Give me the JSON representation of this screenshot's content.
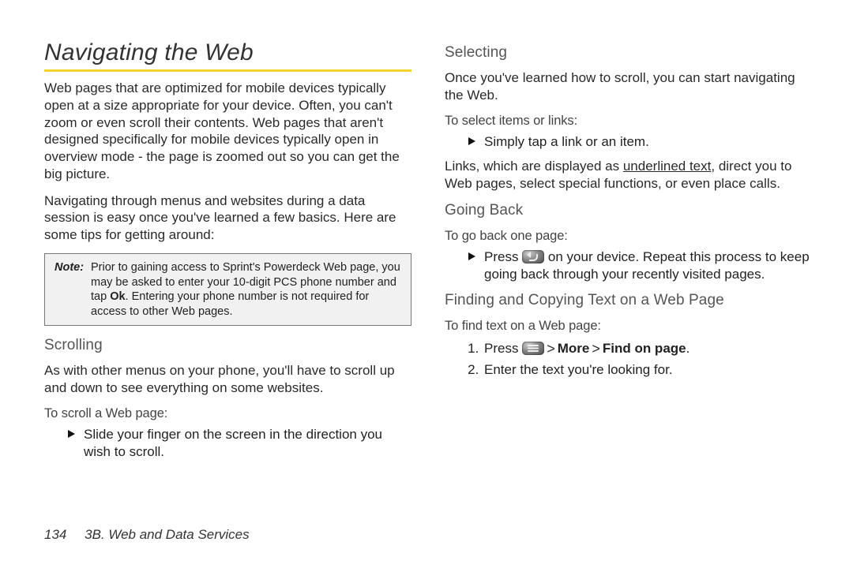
{
  "title": "Navigating the Web",
  "left": {
    "p1": "Web pages that are optimized for mobile devices typically open at a size appropriate for your device. Often, you can't zoom or even scroll their contents. Web pages that aren't designed specifically for mobile devices typically open in overview mode - the page is zoomed out so you can get the big picture.",
    "p2": "Navigating through menus and websites during a data session is easy once you've learned a few basics. Here are some tips for getting around:",
    "note_label": "Note:",
    "note_text_lead": "Prior to gaining access to Sprint's Powerdeck Web page, you may be asked to enter your 10-digit PCS phone number and tap ",
    "note_ok": "Ok",
    "note_text_tail": ". Entering your phone number is not required for access to other Web pages.",
    "scrolling_h": "Scrolling",
    "scrolling_p": "As with other menus on your phone, you'll have to scroll up and down to see everything on some websites.",
    "scrolling_task": "To scroll a Web page:",
    "scrolling_bullet": "Slide your finger on the screen in the direction you wish to scroll."
  },
  "right": {
    "selecting_h": "Selecting",
    "selecting_p1": "Once you've learned how to scroll, you can start navigating the Web.",
    "selecting_task": "To select items or links:",
    "selecting_bullet": "Simply tap a link or an item.",
    "selecting_p2_a": "Links, which are displayed as ",
    "selecting_p2_u": "underlined text",
    "selecting_p2_b": ", direct you to Web pages, select special functions, or even place calls.",
    "goingback_h": "Going Back",
    "goingback_task": "To go back one page:",
    "goingback_bullet_a": "Press ",
    "goingback_bullet_b": " on your device. Repeat this process to keep going back through your recently visited pages.",
    "finding_h": "Finding and Copying Text on a Web Page",
    "finding_task": "To find text on a Web page:",
    "finding_step1_a": "Press ",
    "finding_step1_more": "More",
    "finding_step1_find": "Find on page",
    "finding_step1_period": ".",
    "finding_step2": "Enter the text you're looking for."
  },
  "footer": {
    "page_num": "134",
    "section": "3B. Web and Data Services"
  }
}
